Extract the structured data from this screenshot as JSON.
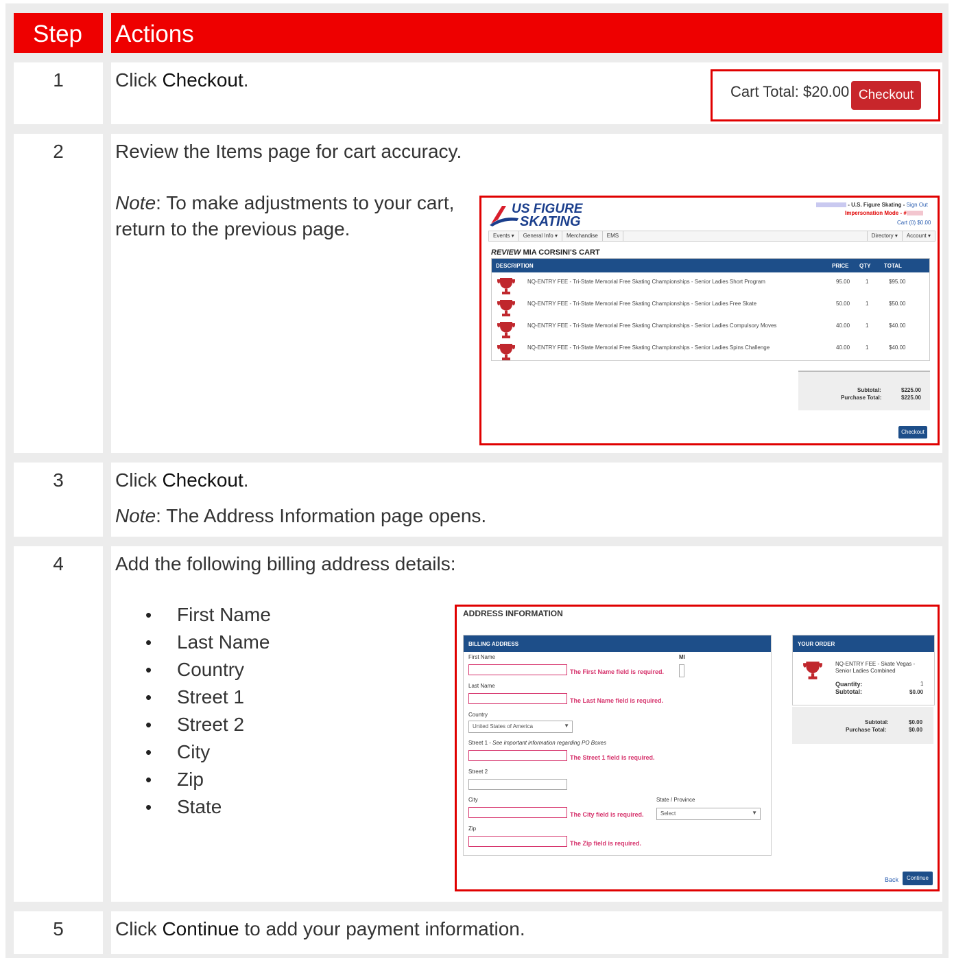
{
  "header": {
    "step": "Step",
    "actions": "Actions"
  },
  "steps": [
    {
      "num": "1",
      "text_pre": "Click ",
      "bold": "Checkout",
      "text_post": "."
    },
    {
      "num": "2",
      "text": "Review the Items page for cart accuracy.",
      "note_label": "Note",
      "note_text": ": To make adjustments to your cart, return to the previous page."
    },
    {
      "num": "3",
      "text_pre": "Click ",
      "bold": "Checkout",
      "text_post": ".",
      "note_label": "Note",
      "note_text": ": The Address Information page opens."
    },
    {
      "num": "4",
      "text": "Add the following billing address details:",
      "fields": [
        "First Name",
        "Last Name",
        "Country",
        "Street 1",
        "Street 2",
        "City",
        "Zip",
        "State"
      ]
    },
    {
      "num": "5",
      "text_pre": "Click ",
      "bold": "Continue",
      "text_post": " to add your payment information."
    }
  ],
  "cart_widget": {
    "total": "Cart Total: $20.00",
    "button": "Checkout"
  },
  "review": {
    "logo_line1": "US FIGURE",
    "logo_line2": "SKATING",
    "top_org": "- U.S. Figure Skating -",
    "sign_out": "Sign Out",
    "impersonation": "Impersonation Mode - #",
    "cart_link": "Cart (0) $0.00",
    "nav_left": [
      "Events ▾",
      "General Info ▾",
      "Merchandise",
      "EMS"
    ],
    "nav_right": [
      "Directory ▾",
      "Account ▾"
    ],
    "title_italic": "REVIEW",
    "title_rest": "MIA CORSINI'S CART",
    "col_desc": "DESCRIPTION",
    "col_price": "PRICE",
    "col_qty": "QTY",
    "col_total": "TOTAL",
    "items": [
      {
        "desc": "NQ-ENTRY FEE - Tri-State Memorial Free Skating Championships - Senior Ladies Short Program",
        "price": "95.00",
        "qty": "1",
        "total": "$95.00"
      },
      {
        "desc": "NQ-ENTRY FEE - Tri-State Memorial Free Skating Championships - Senior Ladies Free Skate",
        "price": "50.00",
        "qty": "1",
        "total": "$50.00"
      },
      {
        "desc": "NQ-ENTRY FEE - Tri-State Memorial Free Skating Championships - Senior Ladies Compulsory Moves",
        "price": "40.00",
        "qty": "1",
        "total": "$40.00"
      },
      {
        "desc": "NQ-ENTRY FEE - Tri-State Memorial Free Skating Championships - Senior Ladies Spins Challenge",
        "price": "40.00",
        "qty": "1",
        "total": "$40.00"
      }
    ],
    "subtotal_label": "Subtotal:",
    "subtotal": "$225.00",
    "purchase_label": "Purchase Total:",
    "purchase_total": "$225.00",
    "checkout": "Checkout"
  },
  "address": {
    "title": "ADDRESS INFORMATION",
    "billing_header": "BILLING ADDRESS",
    "first_name": "First Name",
    "mi": "MI",
    "first_err": "The First Name field is required.",
    "last_name": "Last Name",
    "last_err": "The Last Name field is required.",
    "country": "Country",
    "country_value": "United States of America",
    "street1": "Street 1 -",
    "street1_note": "See important information regarding PO Boxes",
    "street1_err": "The Street 1 field is required.",
    "street2": "Street 2",
    "city": "City",
    "city_err": "The City field is required.",
    "state": "State / Province",
    "state_value": "Select",
    "zip": "Zip",
    "zip_err": "The Zip field is required.",
    "order_header": "YOUR ORDER",
    "order_item_line1": "NQ-ENTRY FEE - Skate Vegas -",
    "order_item_line2": "Senior Ladies Combined",
    "quantity_label": "Quantity:",
    "quantity": "1",
    "subtotal_label": "Subtotal:",
    "subtotal": "$0.00",
    "sum_subtotal_label": "Subtotal:",
    "sum_subtotal": "$0.00",
    "sum_purchase_label": "Purchase Total:",
    "sum_purchase": "$0.00",
    "back": "Back",
    "continue": "Continue"
  },
  "colors": {
    "header_red": "#ee0000",
    "highlight_red": "#e00000",
    "usfs_blue": "#1d4e89",
    "error_pink": "#d6336c",
    "trophy_red": "#c0272d"
  }
}
